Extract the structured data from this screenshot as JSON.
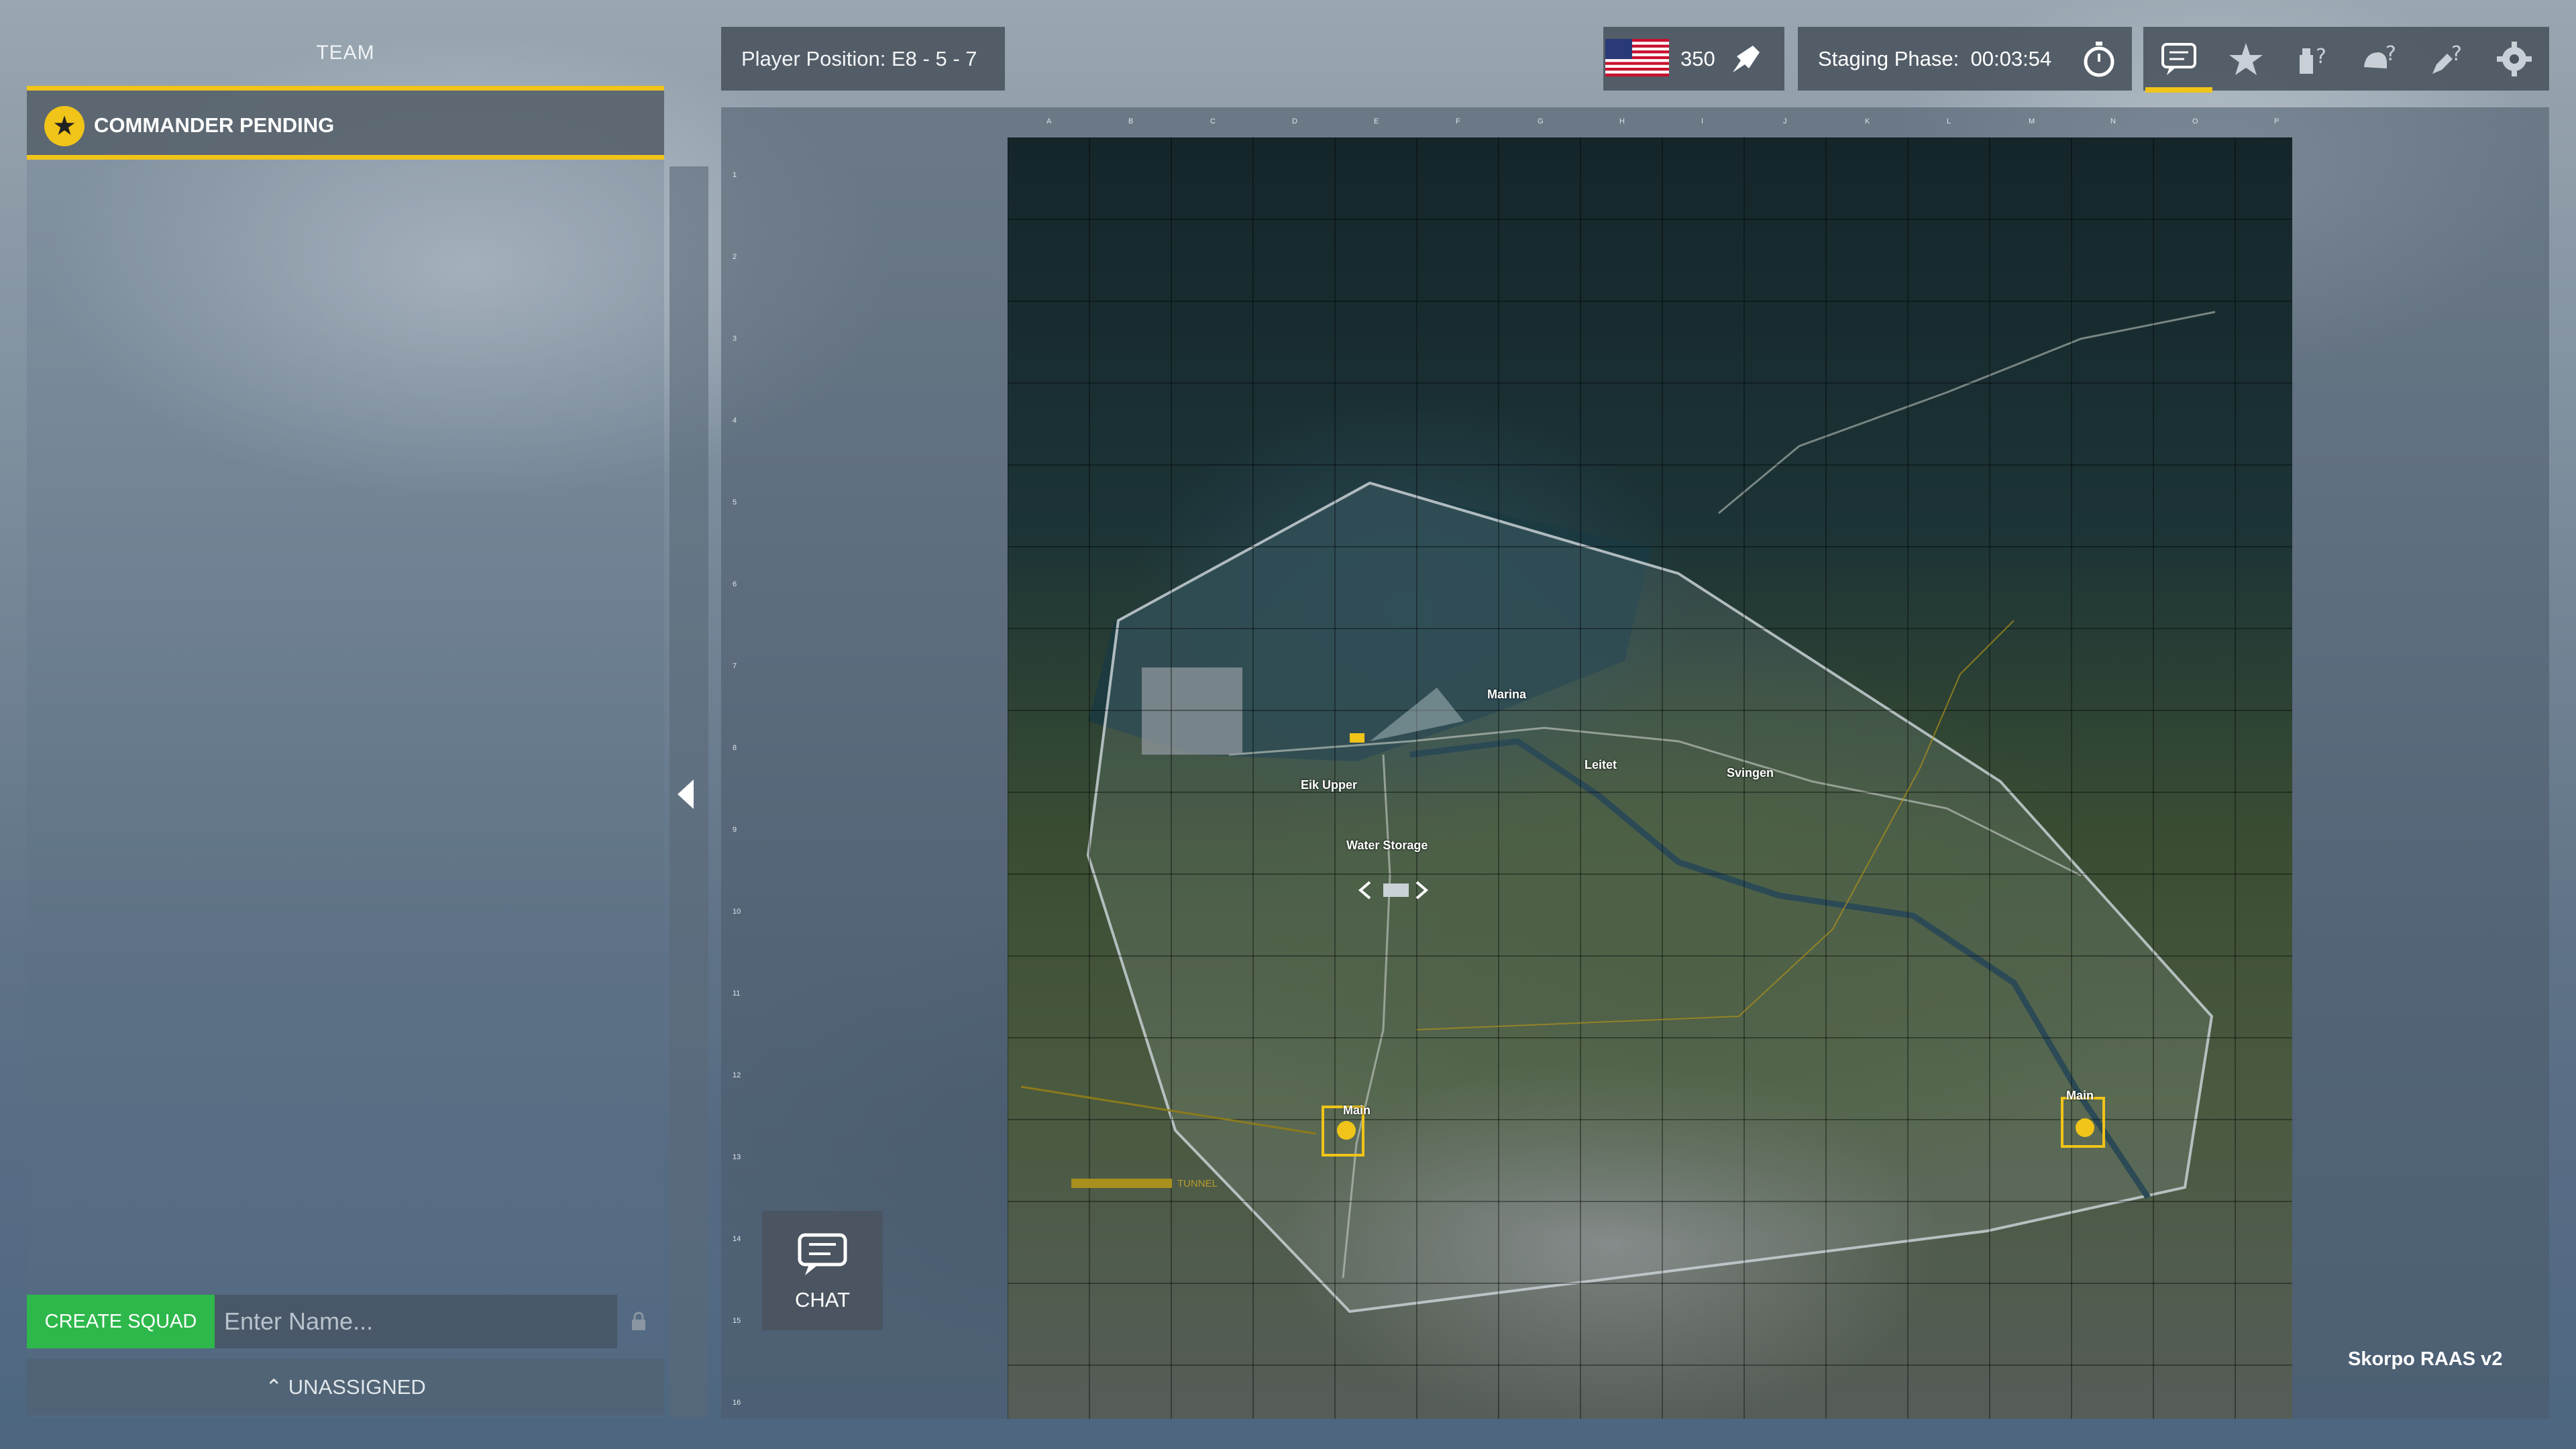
{
  "team_panel": {
    "title": "TEAM",
    "commander_status": "COMMANDER PENDING",
    "create_squad_label": "CREATE SQUAD",
    "squad_name_placeholder": "Enter Name...",
    "unassigned_label": "UNASSIGNED"
  },
  "top_bar": {
    "player_position": "Player Position: E8 - 5 - 7",
    "tickets": "350",
    "phase_label": "Staging Phase:  00:03:54",
    "icons": [
      "chat-icon",
      "star-icon",
      "squad-question-icon",
      "helmet-question-icon",
      "rocket-question-icon",
      "gear-icon"
    ],
    "active_color": "#f0c419"
  },
  "map": {
    "name": "Skorpo RAAS v2",
    "columns": [
      "A",
      "B",
      "C",
      "D",
      "E",
      "F",
      "G",
      "H",
      "I",
      "J",
      "K",
      "L",
      "M",
      "N",
      "O",
      "P"
    ],
    "rows": [
      "1",
      "2",
      "3",
      "4",
      "5",
      "6",
      "7",
      "8",
      "9",
      "10",
      "11",
      "12",
      "13",
      "14",
      "15",
      "16"
    ],
    "locations": [
      {
        "label": "Marina"
      },
      {
        "label": "Leitet"
      },
      {
        "label": "Svingen"
      },
      {
        "label": "Eik Upper"
      },
      {
        "label": "Water Storage"
      },
      {
        "label": "Main"
      },
      {
        "label": "Main"
      }
    ],
    "tunnel_label": "TUNNEL"
  },
  "chat_button": {
    "label": "CHAT"
  }
}
